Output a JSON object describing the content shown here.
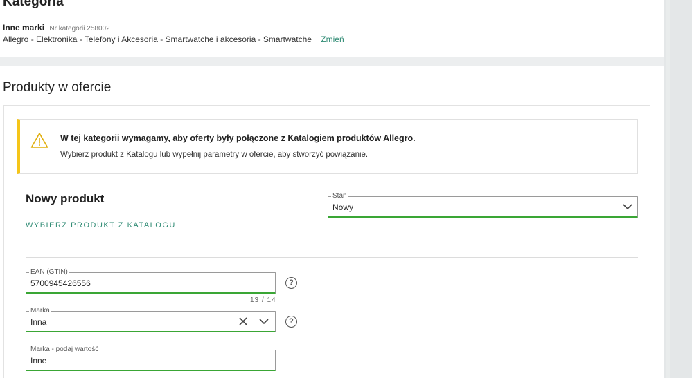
{
  "category": {
    "title": "Kategoria",
    "brand": "Inne marki",
    "category_number": "Nr kategorii 258002",
    "path": "Allegro - Elektronika - Telefony i Akcesoria - Smartwatche i akcesoria - Smartwatche",
    "change_label": "Zmień"
  },
  "products": {
    "title": "Produkty w ofercie",
    "alert": {
      "title": "W tej kategorii wymagamy, aby oferty były połączone z Katalogiem produktów Allegro.",
      "text": "Wybierz produkt z Katalogu lub wypełnij parametry w ofercie, aby stworzyć powiązanie.",
      "accent_color": "#f5c518",
      "icon": "warning-icon"
    },
    "new_product_title": "Nowy produkt",
    "catalog_link": "WYBIERZ PRODUKT Z KATALOGU",
    "condition": {
      "label": "Stan",
      "value": "Nowy"
    },
    "ean": {
      "label": "EAN (GTIN)",
      "value": "5700945426556",
      "counter": "13 / 14"
    },
    "brand_select": {
      "label": "Marka",
      "value": "Inna"
    },
    "brand_value": {
      "label": "Marka - podaj wartość",
      "value": "Inne"
    },
    "help_symbol": "?",
    "accent_color": "#2e8a73",
    "valid_color": "#3aa635"
  }
}
